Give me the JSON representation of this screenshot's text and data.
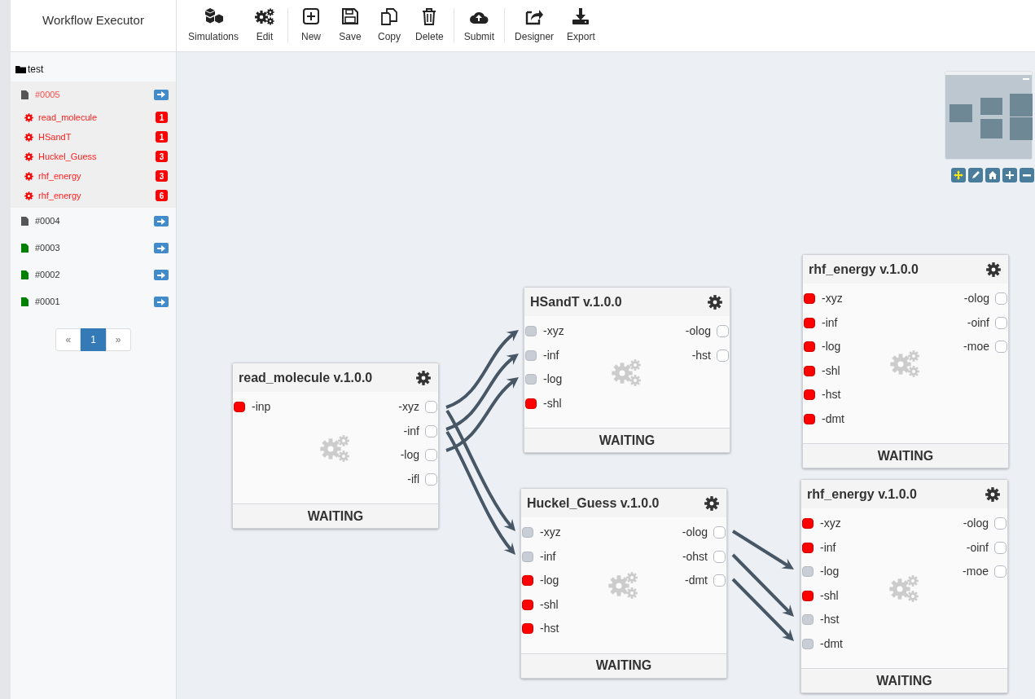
{
  "app": {
    "title": "Workflow Executor"
  },
  "toolbar": {
    "groups": [
      [
        {
          "label": "Simulations"
        },
        {
          "label": "Edit"
        }
      ],
      [
        {
          "label": "New"
        },
        {
          "label": "Save"
        },
        {
          "label": "Copy"
        },
        {
          "label": "Delete"
        }
      ],
      [
        {
          "label": "Submit"
        }
      ],
      [
        {
          "label": "Designer"
        },
        {
          "label": "Export"
        }
      ]
    ]
  },
  "sidebar": {
    "folder": "test",
    "items": [
      {
        "label": "#0005",
        "color": "#555555",
        "selected": true,
        "children": [
          {
            "label": "read_molecule",
            "badge": "1"
          },
          {
            "label": "HSandT",
            "badge": "1"
          },
          {
            "label": "Huckel_Guess",
            "badge": "3"
          },
          {
            "label": "rhf_energy",
            "badge": "3"
          },
          {
            "label": "rhf_energy",
            "badge": "6"
          }
        ]
      },
      {
        "label": "#0004",
        "color": "#555555",
        "selected": false
      },
      {
        "label": "#0003",
        "color": "#008000",
        "selected": false
      },
      {
        "label": "#0002",
        "color": "#008000",
        "selected": false
      },
      {
        "label": "#0001",
        "color": "#008000",
        "selected": false
      }
    ],
    "pagination": [
      {
        "label": "«",
        "selected": false
      },
      {
        "label": "1",
        "selected": true
      },
      {
        "label": "»",
        "selected": false
      }
    ]
  },
  "canvas": {
    "nodes": [
      {
        "title": "read_molecule v.1.0.0",
        "status": "WAITING",
        "inputs": [
          {
            "label": "-inp",
            "connected": false
          }
        ],
        "outputs": [
          "-xyz",
          "-inf",
          "-log",
          "-ifl"
        ]
      },
      {
        "title": "HSandT v.1.0.0",
        "status": "WAITING",
        "inputs": [
          {
            "label": "-xyz",
            "connected": true
          },
          {
            "label": "-inf",
            "connected": true
          },
          {
            "label": "-log",
            "connected": true
          },
          {
            "label": "-shl",
            "connected": false
          }
        ],
        "outputs": [
          "-olog",
          "-hst"
        ]
      },
      {
        "title": "Huckel_Guess v.1.0.0",
        "status": "WAITING",
        "inputs": [
          {
            "label": "-xyz",
            "connected": true
          },
          {
            "label": "-inf",
            "connected": true
          },
          {
            "label": "-log",
            "connected": false
          },
          {
            "label": "-shl",
            "connected": false
          },
          {
            "label": "-hst",
            "connected": false
          }
        ],
        "outputs": [
          "-olog",
          "-ohst",
          "-dmt"
        ]
      },
      {
        "title": "rhf_energy v.1.0.0",
        "status": "WAITING",
        "inputs": [
          {
            "label": "-xyz",
            "connected": false
          },
          {
            "label": "-inf",
            "connected": false
          },
          {
            "label": "-log",
            "connected": false
          },
          {
            "label": "-shl",
            "connected": false
          },
          {
            "label": "-hst",
            "connected": false
          },
          {
            "label": "-dmt",
            "connected": false
          }
        ],
        "outputs": [
          "-olog",
          "-oinf",
          "-moe"
        ]
      },
      {
        "title": "rhf_energy v.1.0.0",
        "status": "WAITING",
        "inputs": [
          {
            "label": "-xyz",
            "connected": false
          },
          {
            "label": "-inf",
            "connected": false
          },
          {
            "label": "-log",
            "connected": true
          },
          {
            "label": "-shl",
            "connected": false
          },
          {
            "label": "-hst",
            "connected": true
          },
          {
            "label": "-dmt",
            "connected": true
          }
        ],
        "outputs": [
          "-olog",
          "-oinf",
          "-moe"
        ]
      }
    ]
  }
}
